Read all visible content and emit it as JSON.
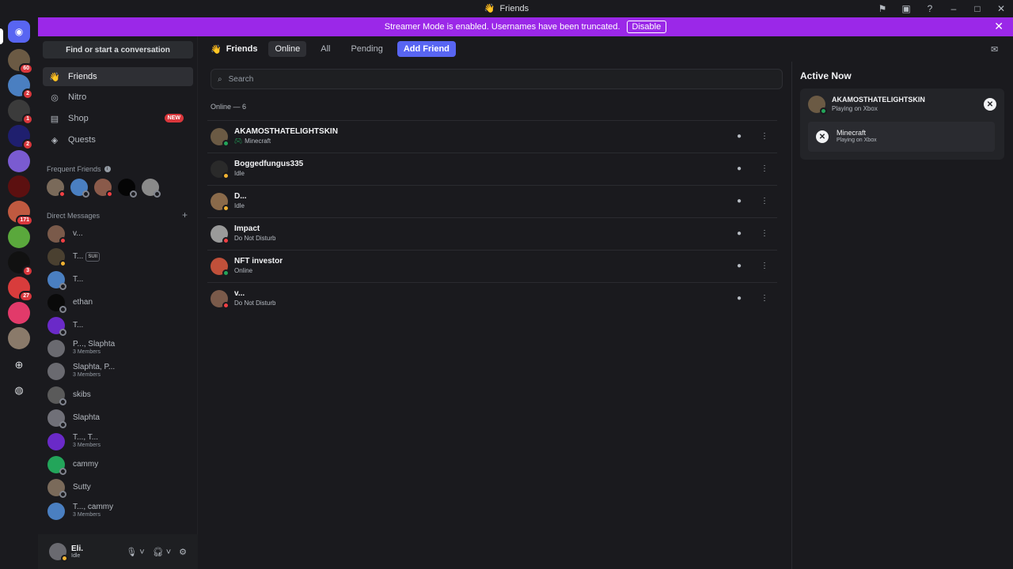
{
  "window": {
    "title": "Friends"
  },
  "banner": {
    "text": "Streamer Mode is enabled. Usernames have been truncated.",
    "button": "Disable"
  },
  "guilds": [
    {
      "color": "#6b5a44",
      "badge": "60"
    },
    {
      "color": "#4a7fc1",
      "badge": "2"
    },
    {
      "color": "#3b3b3b",
      "badge": "1"
    },
    {
      "color": "#1f1f6e",
      "badge": "2"
    },
    {
      "color": "#7a5bd1",
      "badge": ""
    },
    {
      "color": "#5c1010",
      "badge": ""
    },
    {
      "color": "#c05a40",
      "badge": "171"
    },
    {
      "color": "#5aa83c",
      "badge": ""
    },
    {
      "color": "#111111",
      "badge": "3"
    },
    {
      "color": "#d83c3c",
      "badge": "27"
    },
    {
      "color": "#e23a6a",
      "badge": ""
    },
    {
      "color": "#8a7a6a",
      "badge": ""
    }
  ],
  "sidebar": {
    "find": "Find or start a conversation",
    "nav": [
      {
        "label": "Friends",
        "icon": "friends-icon"
      },
      {
        "label": "Nitro",
        "icon": "nitro-icon"
      },
      {
        "label": "Shop",
        "icon": "shop-icon",
        "badge": "NEW"
      },
      {
        "label": "Quests",
        "icon": "quests-icon"
      }
    ],
    "frequent_label": "Frequent Friends",
    "dm_label": "Direct Messages",
    "dms": [
      {
        "name": "v...",
        "sub": "",
        "color": "#7a5a4a",
        "status": "dnd"
      },
      {
        "name": "T...",
        "sub": "",
        "tag": "SUII",
        "color": "#4a4030",
        "status": "idle"
      },
      {
        "name": "T...",
        "sub": "",
        "color": "#4a7fc1",
        "status": "off"
      },
      {
        "name": "ethan",
        "sub": "",
        "color": "#0a0a0a",
        "status": "off"
      },
      {
        "name": "T...",
        "sub": "",
        "color": "#6a2ac8",
        "status": "off"
      },
      {
        "name": "P..., Slaphta",
        "sub": "3 Members",
        "color": "#6a6a70",
        "status": ""
      },
      {
        "name": "Slaphta, P...",
        "sub": "3 Members",
        "color": "#6a6a70",
        "status": ""
      },
      {
        "name": "skibs",
        "sub": "",
        "color": "#5a5a5a",
        "status": "off"
      },
      {
        "name": "Slaphta",
        "sub": "",
        "color": "#707078",
        "status": "off"
      },
      {
        "name": "T..., T...",
        "sub": "3 Members",
        "color": "#6a2ac8",
        "status": ""
      },
      {
        "name": "cammy",
        "sub": "",
        "color": "#23a55a",
        "status": "off"
      },
      {
        "name": "Sutty",
        "sub": "",
        "color": "#7a6a5a",
        "status": "off"
      },
      {
        "name": "T..., cammy",
        "sub": "3 Members",
        "color": "#4a7fc1",
        "status": ""
      }
    ]
  },
  "user": {
    "name": "Eli.",
    "status": "Idle"
  },
  "main": {
    "title": "Friends",
    "tabs": [
      "Online",
      "All",
      "Pending"
    ],
    "add_friend": "Add Friend",
    "search_placeholder": "Search",
    "online_count": "Online — 6",
    "friends": [
      {
        "name": "AKAMOSTHATELIGHTSKIN",
        "sub": "Minecraft",
        "status": "online",
        "color": "#6b5a44",
        "game": true
      },
      {
        "name": "Boggedfungus335",
        "sub": "Idle",
        "status": "idle",
        "color": "#2a2a2a",
        "game": false
      },
      {
        "name": "D...",
        "sub": "Idle",
        "status": "idle",
        "color": "#8a6a4a",
        "game": false
      },
      {
        "name": "Impact",
        "sub": "Do Not Disturb",
        "status": "dnd",
        "color": "#9a9a9a",
        "game": false
      },
      {
        "name": "NFT investor",
        "sub": "Online",
        "status": "online",
        "color": "#c0503a",
        "game": false
      },
      {
        "name": "v...",
        "sub": "Do Not Disturb",
        "status": "dnd",
        "color": "#7a5a4a",
        "game": false
      }
    ]
  },
  "active_now": {
    "title": "Active Now",
    "user": "AKAMOSTHATELIGHTSKIN",
    "user_sub": "Playing on Xbox",
    "game": "Minecraft",
    "game_sub": "Playing on Xbox"
  }
}
